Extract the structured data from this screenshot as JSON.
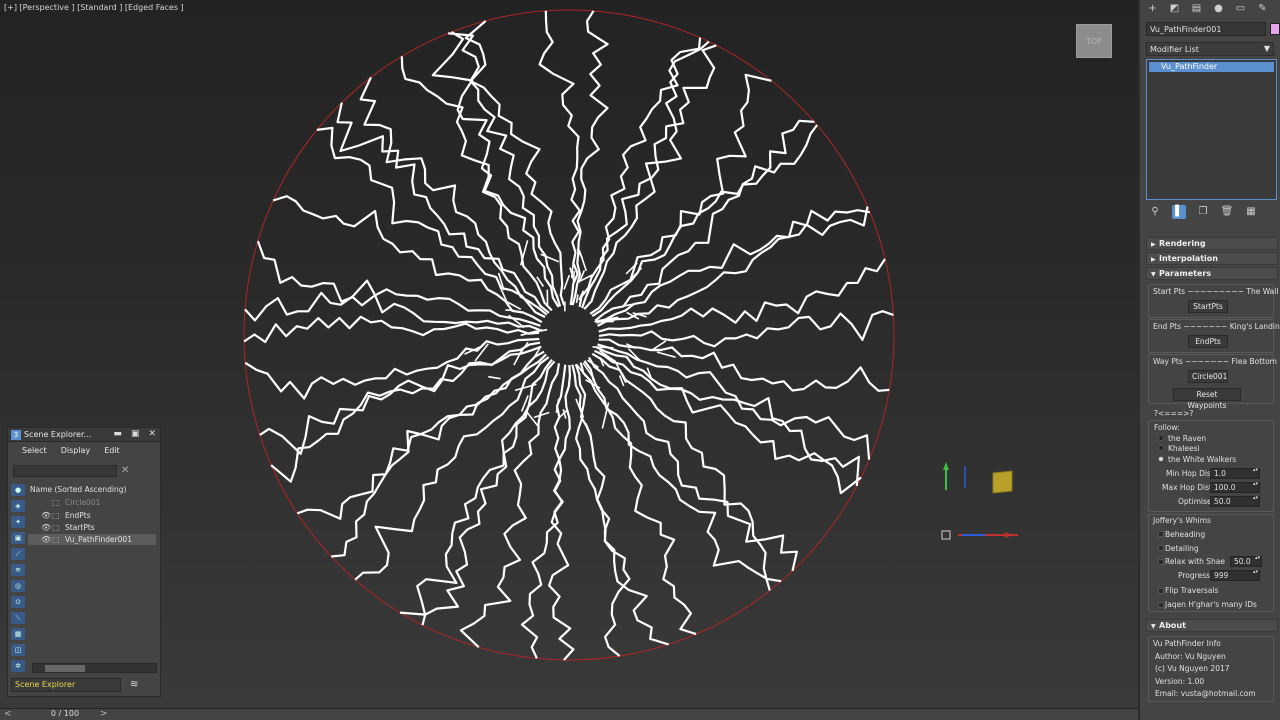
{
  "viewport": {
    "label": "[+] [Perspective ] [Standard ] [Edged Faces ]",
    "viewcube_label": "TOP"
  },
  "timeline": {
    "frame_counter": "0 / 100",
    "prev_arrow": "<",
    "next_arrow": ">"
  },
  "command_panel": {
    "tab_icons": [
      "create-icon",
      "modify-icon",
      "hierarchy-icon",
      "motion-icon",
      "display-icon",
      "utilities-icon"
    ],
    "object_name": "Vu_PathFinder001",
    "object_color": "#e6a3e6",
    "modifier_list_label": "Modifier List",
    "stack_item": "Vu_PathFinder",
    "rollouts": {
      "rendering": "Rendering",
      "interpolation": "Interpolation",
      "parameters": "Parameters",
      "about": "About"
    },
    "parameters": {
      "start_pts_label": "Start Pts ~~~~~~~~~ The Wall",
      "start_pts_button": "StartPts",
      "end_pts_label": "End Pts ~~~~~~~ King's Landing",
      "end_pts_button": "EndPts",
      "way_pts_label": "Way Pts ~~~~~~~ Flea Bottom",
      "way_pts_button": "Circle001",
      "reset_waypoints": "Reset Waypoints",
      "divider": "?<===>?",
      "follow_label": "Follow:",
      "follow_options": [
        "the Raven",
        "Khaleesi",
        "the White Walkers"
      ],
      "follow_selected": 2,
      "min_hop_label": "Min Hop Dist",
      "min_hop_value": "1.0",
      "max_hop_label": "Max Hop Dist",
      "max_hop_value": "100.0",
      "optimise_label": "Optimise",
      "optimise_value": "50.0",
      "whims_title": "Joffery's Whims",
      "beheading": "Beheading",
      "detailing": "Detailing",
      "relax_label": "Relax with Shae",
      "relax_value": "50.0",
      "progress_label": "Progress",
      "progress_value": "999",
      "flip_traversals": "Flip Traversals",
      "jaqen": "Jaqen H'ghar's many IDs"
    },
    "about": {
      "title": "Vu PathFinder Info",
      "author": "Author: Vu Nguyen",
      "copyright": "(c) Vu Nguyen 2017",
      "version": "Version: 1.00",
      "email": "Email: vusta@hotmail.com"
    }
  },
  "scene_explorer": {
    "title": "Scene Explorer...",
    "menu": [
      "Select",
      "Display",
      "Edit"
    ],
    "column_header": "Name (Sorted Ascending)",
    "rows": [
      {
        "name": "Circle001",
        "visible": false,
        "selected": false
      },
      {
        "name": "EndPts",
        "visible": true,
        "selected": false
      },
      {
        "name": "StartPts",
        "visible": true,
        "selected": false
      },
      {
        "name": "Vu_PathFinder001",
        "visible": true,
        "selected": true
      }
    ],
    "footer": "Scene Explorer"
  }
}
